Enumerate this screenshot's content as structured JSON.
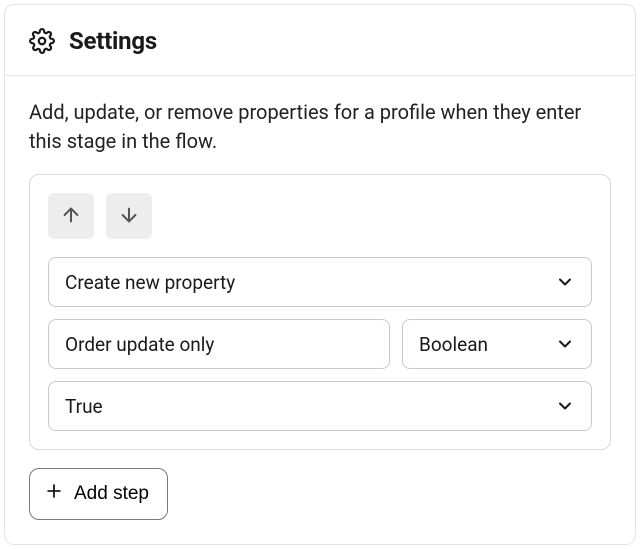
{
  "header": {
    "title": "Settings"
  },
  "description": "Add, update, or remove properties for a profile when they enter this stage in the flow.",
  "card": {
    "action_select": "Create new property",
    "property_name": "Order update only",
    "type_select": "Boolean",
    "value_select": "True"
  },
  "buttons": {
    "add_step": "Add step"
  }
}
